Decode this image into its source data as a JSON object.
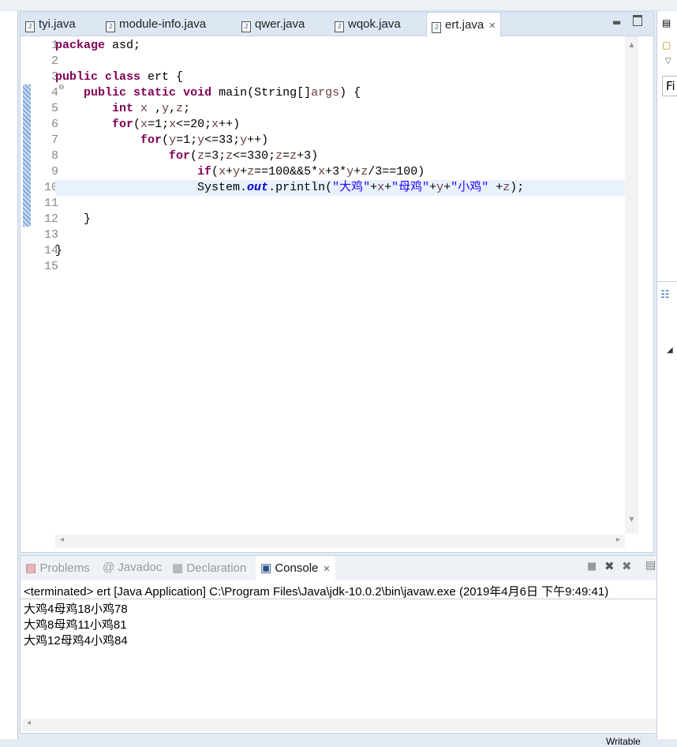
{
  "editor": {
    "tabs": [
      {
        "label": "tyi.java",
        "active": false
      },
      {
        "label": "module-info.java",
        "active": false
      },
      {
        "label": "qwer.java",
        "active": false
      },
      {
        "label": "wqok.java",
        "active": false
      },
      {
        "label": "ert.java",
        "active": true
      }
    ],
    "current_line": 10,
    "lines": [
      [
        {
          "k": "kw",
          "t": "package"
        },
        {
          "k": "",
          "t": " asd;"
        }
      ],
      [],
      [
        {
          "k": "kw",
          "t": "public"
        },
        {
          "k": "",
          "t": " "
        },
        {
          "k": "kw",
          "t": "class"
        },
        {
          "k": "",
          "t": " ert {"
        }
      ],
      [
        {
          "k": "",
          "t": "    "
        },
        {
          "k": "kw",
          "t": "public"
        },
        {
          "k": "",
          "t": " "
        },
        {
          "k": "kw",
          "t": "static"
        },
        {
          "k": "",
          "t": " "
        },
        {
          "k": "kw",
          "t": "void"
        },
        {
          "k": "",
          "t": " main(String[]"
        },
        {
          "k": "var",
          "t": "args"
        },
        {
          "k": "",
          "t": ") {"
        }
      ],
      [
        {
          "k": "",
          "t": "        "
        },
        {
          "k": "kw",
          "t": "int"
        },
        {
          "k": "",
          "t": " "
        },
        {
          "k": "var",
          "t": "x"
        },
        {
          "k": "",
          "t": " ,"
        },
        {
          "k": "var",
          "t": "y"
        },
        {
          "k": "",
          "t": ","
        },
        {
          "k": "var",
          "t": "z"
        },
        {
          "k": "",
          "t": ";"
        }
      ],
      [
        {
          "k": "",
          "t": "        "
        },
        {
          "k": "kw",
          "t": "for"
        },
        {
          "k": "",
          "t": "("
        },
        {
          "k": "var",
          "t": "x"
        },
        {
          "k": "",
          "t": "=1;"
        },
        {
          "k": "var",
          "t": "x"
        },
        {
          "k": "",
          "t": "<=20;"
        },
        {
          "k": "var",
          "t": "x"
        },
        {
          "k": "",
          "t": "++)"
        }
      ],
      [
        {
          "k": "",
          "t": "            "
        },
        {
          "k": "kw",
          "t": "for"
        },
        {
          "k": "",
          "t": "("
        },
        {
          "k": "var",
          "t": "y"
        },
        {
          "k": "",
          "t": "=1;"
        },
        {
          "k": "var",
          "t": "y"
        },
        {
          "k": "",
          "t": "<=33;"
        },
        {
          "k": "var",
          "t": "y"
        },
        {
          "k": "",
          "t": "++)"
        }
      ],
      [
        {
          "k": "",
          "t": "                "
        },
        {
          "k": "kw",
          "t": "for"
        },
        {
          "k": "",
          "t": "("
        },
        {
          "k": "var",
          "t": "z"
        },
        {
          "k": "",
          "t": "=3;"
        },
        {
          "k": "var",
          "t": "z"
        },
        {
          "k": "",
          "t": "<=330;"
        },
        {
          "k": "var",
          "t": "z"
        },
        {
          "k": "",
          "t": "="
        },
        {
          "k": "var",
          "t": "z"
        },
        {
          "k": "",
          "t": "+3)"
        }
      ],
      [
        {
          "k": "",
          "t": "                    "
        },
        {
          "k": "kw",
          "t": "if"
        },
        {
          "k": "",
          "t": "("
        },
        {
          "k": "var",
          "t": "x"
        },
        {
          "k": "",
          "t": "+"
        },
        {
          "k": "var",
          "t": "y"
        },
        {
          "k": "",
          "t": "+"
        },
        {
          "k": "var",
          "t": "z"
        },
        {
          "k": "",
          "t": "==100&&5*"
        },
        {
          "k": "var",
          "t": "x"
        },
        {
          "k": "",
          "t": "+3*"
        },
        {
          "k": "var",
          "t": "y"
        },
        {
          "k": "",
          "t": "+"
        },
        {
          "k": "var",
          "t": "z"
        },
        {
          "k": "",
          "t": "/3==100)"
        }
      ],
      [
        {
          "k": "",
          "t": "                    System."
        },
        {
          "k": "fld",
          "t": "out"
        },
        {
          "k": "",
          "t": ".println("
        },
        {
          "k": "str",
          "t": "\"大鸡\""
        },
        {
          "k": "",
          "t": "+"
        },
        {
          "k": "var",
          "t": "x"
        },
        {
          "k": "",
          "t": "+"
        },
        {
          "k": "str",
          "t": "\"母鸡\""
        },
        {
          "k": "",
          "t": "+"
        },
        {
          "k": "var",
          "t": "y"
        },
        {
          "k": "",
          "t": "+"
        },
        {
          "k": "str",
          "t": "\"小鸡\""
        },
        {
          "k": "",
          "t": " +"
        },
        {
          "k": "var",
          "t": "z"
        },
        {
          "k": "",
          "t": ");"
        }
      ],
      [],
      [
        {
          "k": "",
          "t": "    }"
        }
      ],
      [],
      [
        {
          "k": "",
          "t": "}"
        }
      ],
      []
    ]
  },
  "console": {
    "tabs": [
      {
        "label": "Problems",
        "icon": "problems-icon",
        "active": false
      },
      {
        "label": "Javadoc",
        "icon": "at-icon",
        "active": false
      },
      {
        "label": "Declaration",
        "icon": "declaration-icon",
        "active": false
      },
      {
        "label": "Console",
        "icon": "console-icon",
        "active": true
      }
    ],
    "status": "<terminated> ert [Java Application] C:\\Program Files\\Java\\jdk-10.0.2\\bin\\javaw.exe (2019年4月6日 下午9:49:41)",
    "output": [
      "大鸡4母鸡18小鸡78",
      "大鸡8母鸡11小鸡81",
      "大鸡12母鸡4小鸡84"
    ]
  },
  "right_panel": {
    "filter_text": "Fi"
  },
  "statusbar": {
    "writable": "Writable"
  }
}
